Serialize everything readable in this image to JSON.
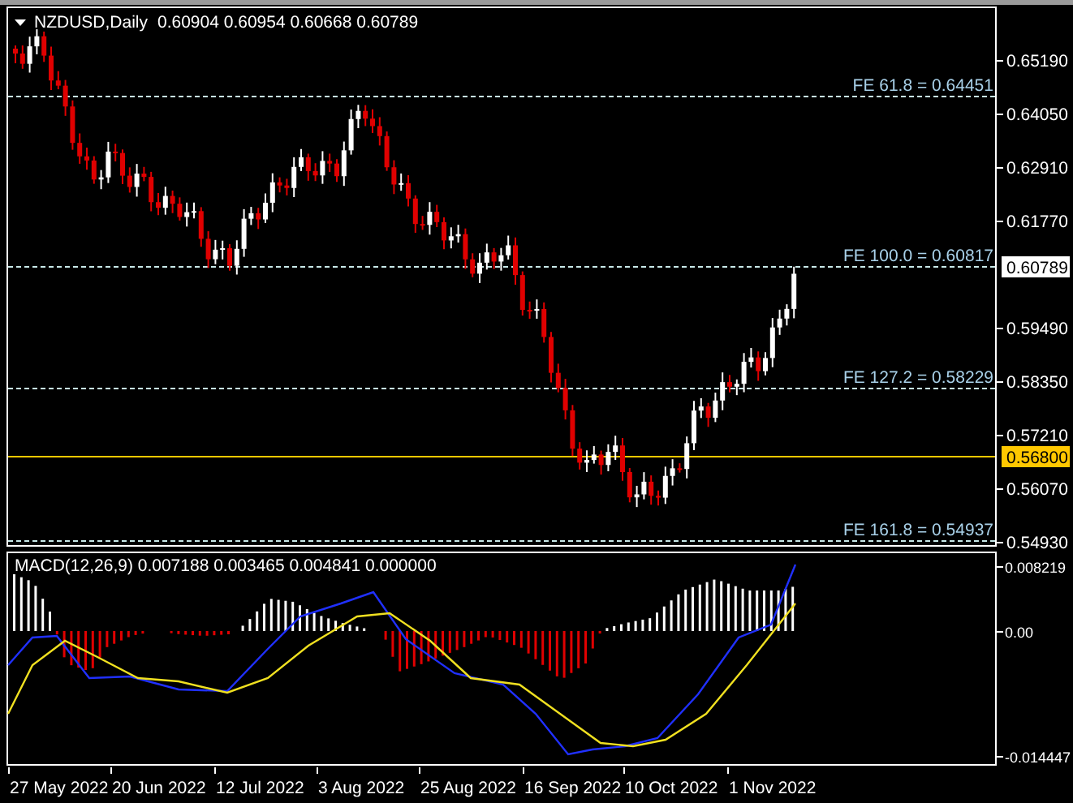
{
  "chart": {
    "symbol": "NZDUSD,Daily",
    "ohlc": "0.60904 0.60954 0.60668 0.60789"
  },
  "fe_levels": [
    {
      "label": "FE 61.8 = 0.64451"
    },
    {
      "label": "FE 100.0 = 0.60817"
    },
    {
      "label": "FE 127.2 = 0.58229"
    },
    {
      "label": "FE 161.8 = 0.54937"
    }
  ],
  "price_axis": {
    "ticks": [
      "0.65190",
      "0.64050",
      "0.62910",
      "0.61770",
      "0.59490",
      "0.58350",
      "0.57210",
      "0.56070",
      "0.54930"
    ],
    "current_price": "0.60789",
    "line_price": "0.56800"
  },
  "macd": {
    "label": "MACD(12,26,9) 0.007188 0.003465 0.004841 0.000000",
    "ticks": [
      "0.008219",
      "0.00",
      "-0.014447"
    ]
  },
  "time_axis": {
    "dates": [
      "27 May 2022",
      "20 Jun 2022",
      "12 Jul 2022",
      "3 Aug 2022",
      "25 Aug 2022",
      "16 Sep 2022",
      "10 Oct 2022",
      "1 Nov 2022"
    ]
  }
}
